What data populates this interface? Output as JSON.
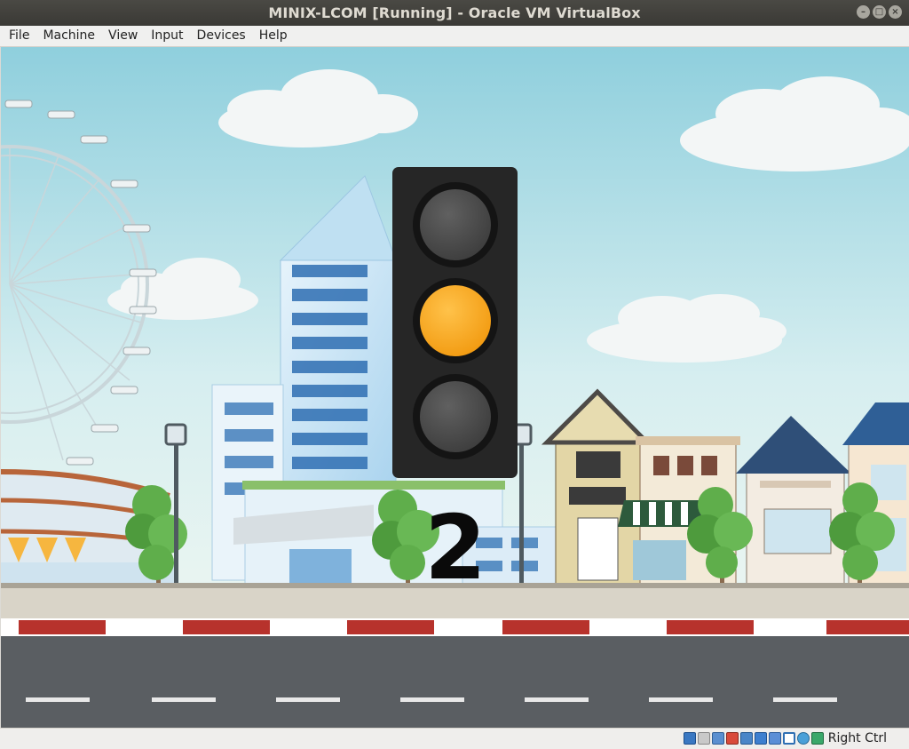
{
  "window": {
    "title": "MINIX-LCOM [Running] - Oracle VM VirtualBox",
    "controls": [
      "minimize",
      "maximize",
      "close"
    ]
  },
  "menubar": {
    "items": [
      {
        "label": "File"
      },
      {
        "label": "Machine"
      },
      {
        "label": "View"
      },
      {
        "label": "Input"
      },
      {
        "label": "Devices"
      },
      {
        "label": "Help"
      }
    ]
  },
  "scene": {
    "traffic_light": {
      "active_light": "amber",
      "lamps": [
        "off",
        "amber",
        "off"
      ],
      "colors": {
        "housing": "#262626",
        "off": "#4b4b4b",
        "amber": "#f6a01f"
      }
    },
    "countdown": "2"
  },
  "statusbar": {
    "icons": [
      "hard-disk-icon",
      "optical-drive-icon",
      "audio-icon",
      "network-icon",
      "usb-icon",
      "shared-folders-icon",
      "display-icon",
      "video-capture-icon",
      "mouse-integration-icon",
      "keyboard-capture-icon"
    ],
    "host_key": "Right Ctrl"
  }
}
